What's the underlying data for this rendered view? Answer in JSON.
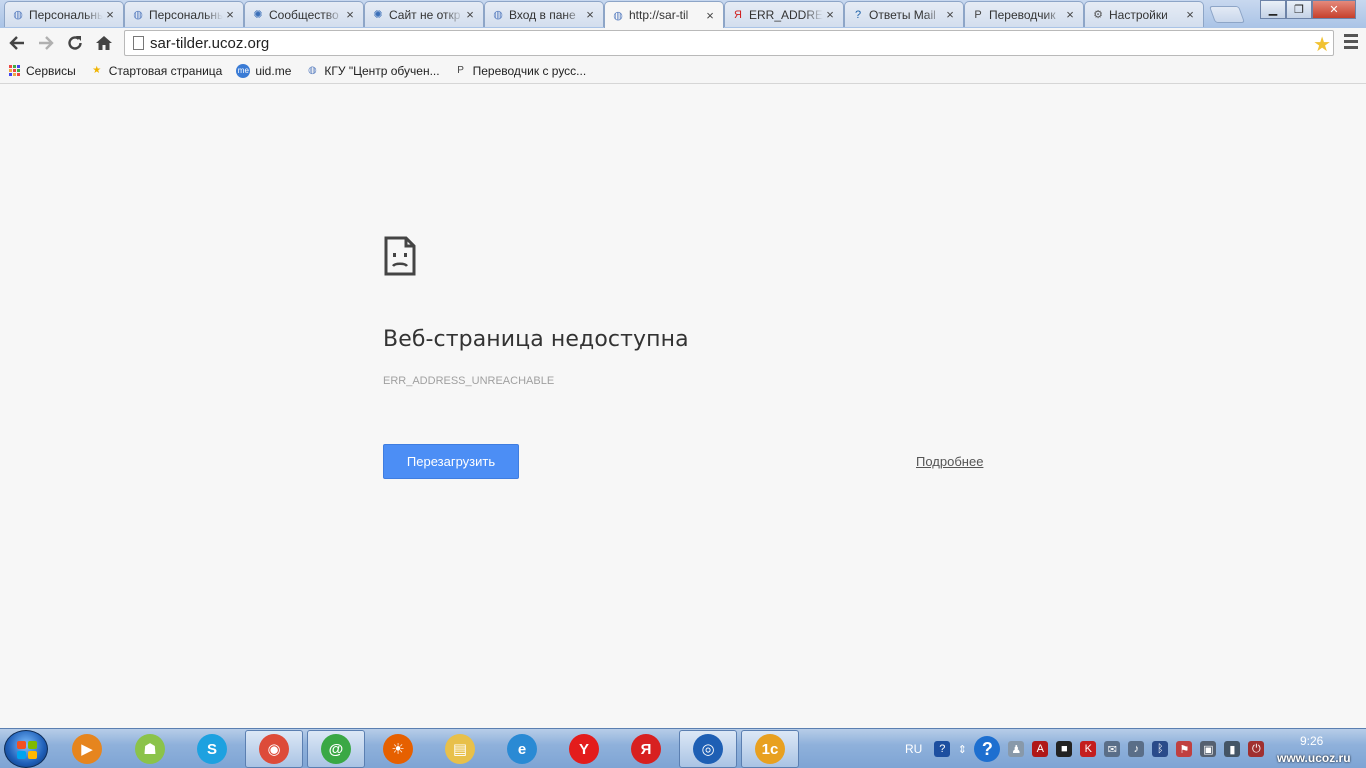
{
  "browser": {
    "tabs": [
      {
        "title": "Персональный",
        "icon": "ucoz-icon",
        "active": false
      },
      {
        "title": "Персональный",
        "icon": "ucoz-icon",
        "active": false
      },
      {
        "title": "Сообщество",
        "icon": "community-icon",
        "active": false
      },
      {
        "title": "Сайт не откр",
        "icon": "community-icon",
        "active": false
      },
      {
        "title": "Вход в пане",
        "icon": "ucoz-icon",
        "active": false
      },
      {
        "title": "http://sar-til",
        "icon": "ucoz-icon",
        "active": true
      },
      {
        "title": "ERR_ADDRE",
        "icon": "yandex-icon",
        "active": false
      },
      {
        "title": "Ответы Mail",
        "icon": "question-icon",
        "active": false
      },
      {
        "title": "Переводчик",
        "icon": "translator-icon",
        "active": false
      },
      {
        "title": "Настройки",
        "icon": "gear-icon",
        "active": false
      }
    ],
    "tab_close_glyph": "×",
    "url": "sar-tilder.ucoz.org",
    "bookmarks": [
      {
        "label": "Сервисы",
        "icon": "apps-icon"
      },
      {
        "label": "Стартовая страница",
        "icon": "star-page-icon"
      },
      {
        "label": "uid.me",
        "icon": "uid-icon"
      },
      {
        "label": "КГУ \"Центр обучен...",
        "icon": "ucoz-icon"
      },
      {
        "label": "Переводчик с русс...",
        "icon": "translator-icon"
      }
    ]
  },
  "error_page": {
    "title": "Веб-страница недоступна",
    "code": "ERR_ADDRESS_UNREACHABLE",
    "reload_label": "Перезагрузить",
    "details_label": "Подробнее"
  },
  "taskbar": {
    "apps": [
      "media-player-icon",
      "android-icon",
      "skype-icon",
      "chrome-icon",
      "mail-agent-icon",
      "firefox-icon",
      "explorer-folder-icon",
      "internet-explorer-icon",
      "yandex-y-icon",
      "yandex-browser-icon",
      "browser-globe-icon",
      "1c-icon"
    ],
    "language": "RU",
    "clock": "9:26"
  },
  "watermark": "www.ucoz.ru",
  "colors": {
    "accent": "#4c8ef5",
    "tabbar": "#a9c3e6",
    "taskbar": "#8fb1db"
  }
}
